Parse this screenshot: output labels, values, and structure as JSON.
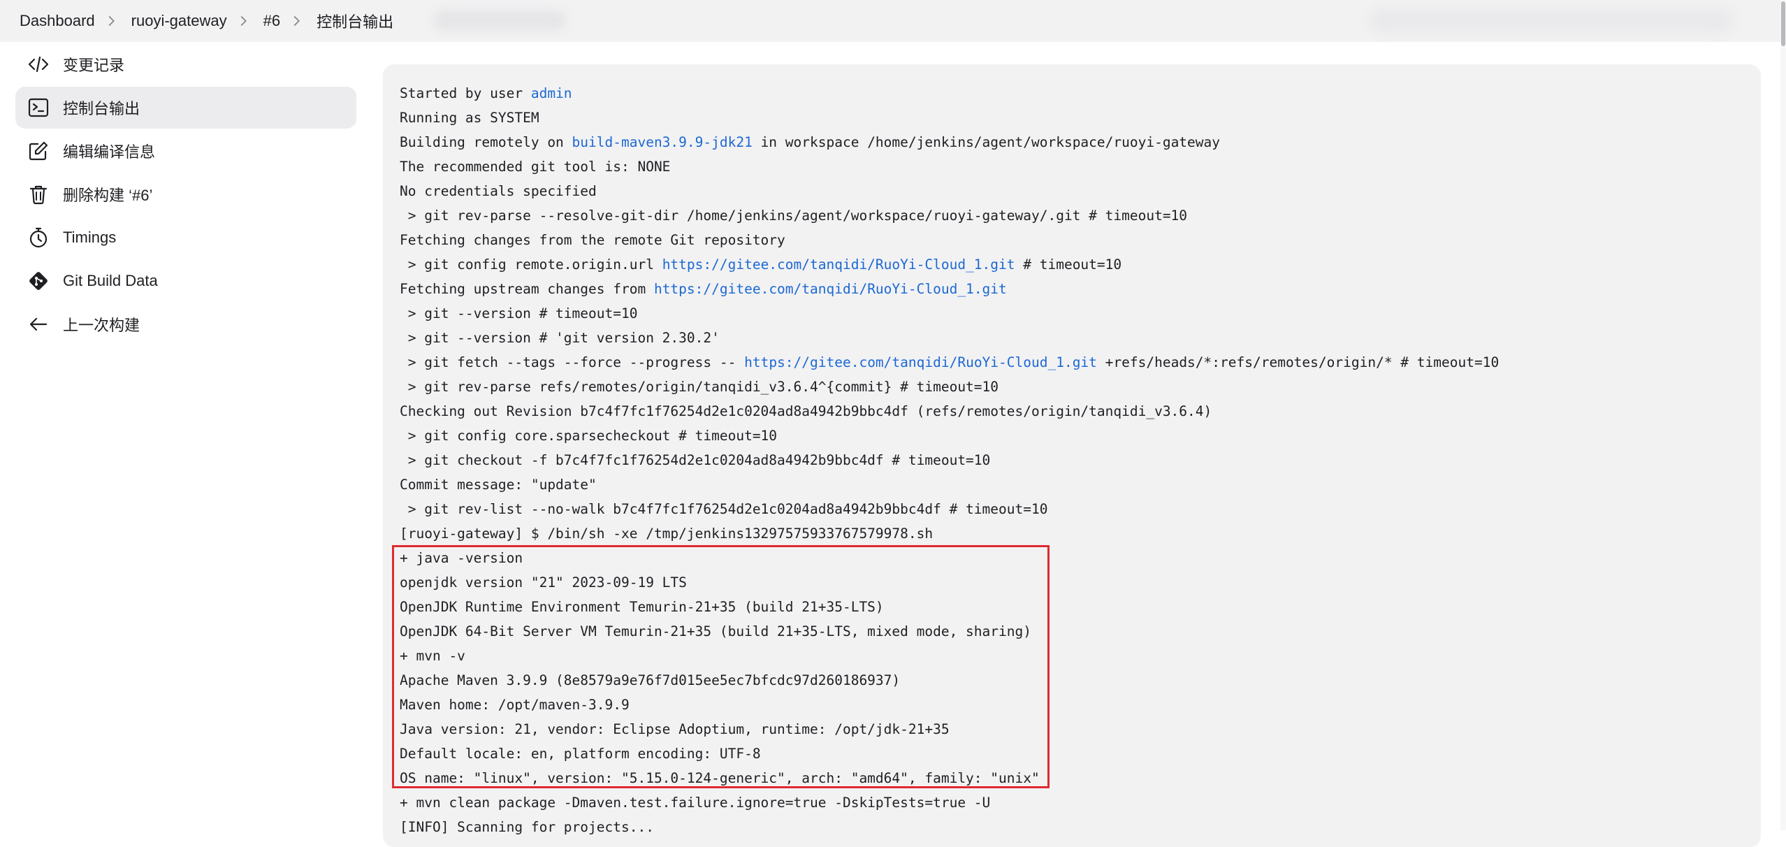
{
  "breadcrumb": [
    {
      "label": "Dashboard"
    },
    {
      "label": "ruoyi-gateway"
    },
    {
      "label": "#6"
    },
    {
      "label": "控制台输出"
    }
  ],
  "sidebar": {
    "items": [
      {
        "label": "变更记录",
        "icon": "code-icon",
        "active": false
      },
      {
        "label": "控制台输出",
        "icon": "terminal-icon",
        "active": true
      },
      {
        "label": "编辑编译信息",
        "icon": "edit-icon",
        "active": false
      },
      {
        "label": "删除构建 ‘#6’",
        "icon": "trash-icon",
        "active": false
      },
      {
        "label": "Timings",
        "icon": "stopwatch-icon",
        "active": false
      },
      {
        "label": "Git Build Data",
        "icon": "git-icon",
        "active": false
      },
      {
        "label": "上一次构建",
        "icon": "arrow-left-icon",
        "active": false
      }
    ]
  },
  "console": {
    "link_color": "#1c68d2",
    "highlight_color": "#e02a2f",
    "lines": [
      [
        {
          "t": "Started by user "
        },
        {
          "t": "admin",
          "link": true
        }
      ],
      [
        {
          "t": "Running as SYSTEM"
        }
      ],
      [
        {
          "t": "Building remotely on "
        },
        {
          "t": "build-maven3.9.9-jdk21",
          "link": true
        },
        {
          "t": " in workspace /home/jenkins/agent/workspace/ruoyi-gateway"
        }
      ],
      [
        {
          "t": "The recommended git tool is: NONE"
        }
      ],
      [
        {
          "t": "No credentials specified"
        }
      ],
      [
        {
          "t": " > git rev-parse --resolve-git-dir /home/jenkins/agent/workspace/ruoyi-gateway/.git # timeout=10"
        }
      ],
      [
        {
          "t": "Fetching changes from the remote Git repository"
        }
      ],
      [
        {
          "t": " > git config remote.origin.url "
        },
        {
          "t": "https://gitee.com/tanqidi/RuoYi-Cloud_1.git",
          "link": true
        },
        {
          "t": " # timeout=10"
        }
      ],
      [
        {
          "t": "Fetching upstream changes from "
        },
        {
          "t": "https://gitee.com/tanqidi/RuoYi-Cloud_1.git",
          "link": true
        }
      ],
      [
        {
          "t": " > git --version # timeout=10"
        }
      ],
      [
        {
          "t": " > git --version # 'git version 2.30.2'"
        }
      ],
      [
        {
          "t": " > git fetch --tags --force --progress -- "
        },
        {
          "t": "https://gitee.com/tanqidi/RuoYi-Cloud_1.git",
          "link": true
        },
        {
          "t": " +refs/heads/*:refs/remotes/origin/* # timeout=10"
        }
      ],
      [
        {
          "t": " > git rev-parse refs/remotes/origin/tanqidi_v3.6.4^{commit} # timeout=10"
        }
      ],
      [
        {
          "t": "Checking out Revision b7c4f7fc1f76254d2e1c0204ad8a4942b9bbc4df (refs/remotes/origin/tanqidi_v3.6.4)"
        }
      ],
      [
        {
          "t": " > git config core.sparsecheckout # timeout=10"
        }
      ],
      [
        {
          "t": " > git checkout -f b7c4f7fc1f76254d2e1c0204ad8a4942b9bbc4df # timeout=10"
        }
      ],
      [
        {
          "t": "Commit message: \"update\""
        }
      ],
      [
        {
          "t": " > git rev-list --no-walk b7c4f7fc1f76254d2e1c0204ad8a4942b9bbc4df # timeout=10"
        }
      ],
      [
        {
          "t": "[ruoyi-gateway] $ /bin/sh -xe /tmp/jenkins13297575933767579978.sh"
        }
      ],
      [
        {
          "t": "+ java -version"
        }
      ],
      [
        {
          "t": "openjdk version \"21\" 2023-09-19 LTS"
        }
      ],
      [
        {
          "t": "OpenJDK Runtime Environment Temurin-21+35 (build 21+35-LTS)"
        }
      ],
      [
        {
          "t": "OpenJDK 64-Bit Server VM Temurin-21+35 (build 21+35-LTS, mixed mode, sharing)"
        }
      ],
      [
        {
          "t": "+ mvn -v"
        }
      ],
      [
        {
          "t": "Apache Maven 3.9.9 (8e8579a9e76f7d015ee5ec7bfcdc97d260186937)"
        }
      ],
      [
        {
          "t": "Maven home: /opt/maven-3.9.9"
        }
      ],
      [
        {
          "t": "Java version: 21, vendor: Eclipse Adoptium, runtime: /opt/jdk-21+35"
        }
      ],
      [
        {
          "t": "Default locale: en, platform encoding: UTF-8"
        }
      ],
      [
        {
          "t": "OS name: \"linux\", version: \"5.15.0-124-generic\", arch: \"amd64\", family: \"unix\""
        }
      ],
      [
        {
          "t": "+ mvn clean package -Dmaven.test.failure.ignore=true -DskipTests=true -U"
        }
      ],
      [
        {
          "t": "[INFO] Scanning for projects..."
        }
      ]
    ]
  }
}
